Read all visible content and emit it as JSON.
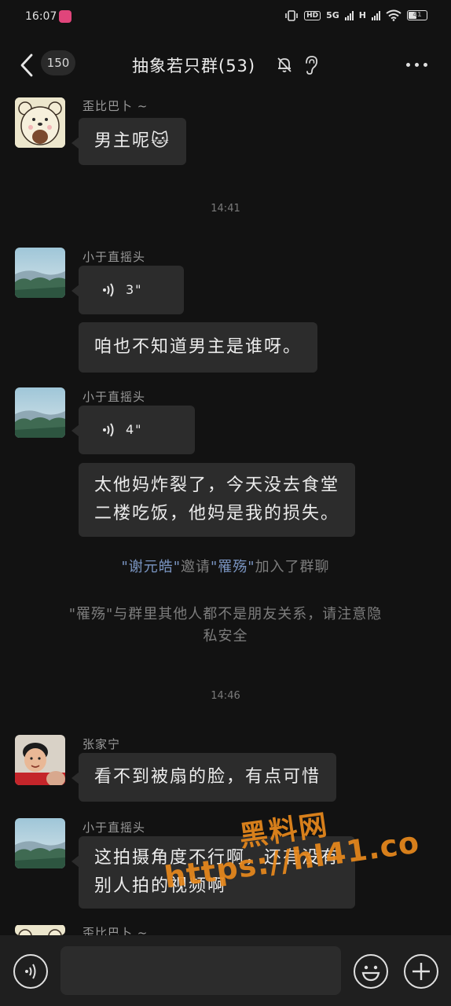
{
  "status_bar": {
    "time": "16:07",
    "hd_label": "HD",
    "network": "5G",
    "network2": "H",
    "battery": "41"
  },
  "header": {
    "back_icon": "chevron-left-icon",
    "unread_count": "150",
    "title": "抽象若只群(53)",
    "mute_icon": "bell-off-icon",
    "ear_icon": "ear-icon",
    "more_icon": "more-dots-icon"
  },
  "messages": [
    {
      "sender": "歪比巴卜 ~",
      "text": "男主呢🐱"
    },
    {
      "time": "14:41"
    },
    {
      "sender": "小于直摇头",
      "voice_duration": "3\""
    },
    {
      "text": "咱也不知道男主是谁呀。"
    },
    {
      "sender": "小于直摇头",
      "voice_duration": "4\""
    },
    {
      "text_line1": "太他妈炸裂了，今天没去食堂",
      "text_line2": "二楼吃饭，他妈是我的损失。"
    },
    {
      "system_invite": {
        "inviter": "\"谢元皓\"",
        "action1": "邀请",
        "invitee": "\"罹殇\"",
        "action2": "加入了群聊"
      }
    },
    {
      "system_notice_line1": "\"罹殇\"与群里其他人都不是朋友关系，请注意隐",
      "system_notice_line2": "私安全"
    },
    {
      "time": "14:46"
    },
    {
      "sender": "张家宁",
      "text": "看不到被扇的脸，有点可惜"
    },
    {
      "sender": "小于直摇头",
      "text_line1": "这拍摄角度不行啊，还有没有",
      "text_line2": "别人拍的视频啊"
    },
    {
      "sender": "歪比巴卜 ~"
    }
  ],
  "watermark": {
    "line1": "黑料网",
    "line2": "https://hl41.co"
  },
  "input_bar": {
    "voice_icon": "voice-icon",
    "emoji_icon": "emoji-icon",
    "plus_icon": "plus-icon",
    "placeholder": ""
  }
}
